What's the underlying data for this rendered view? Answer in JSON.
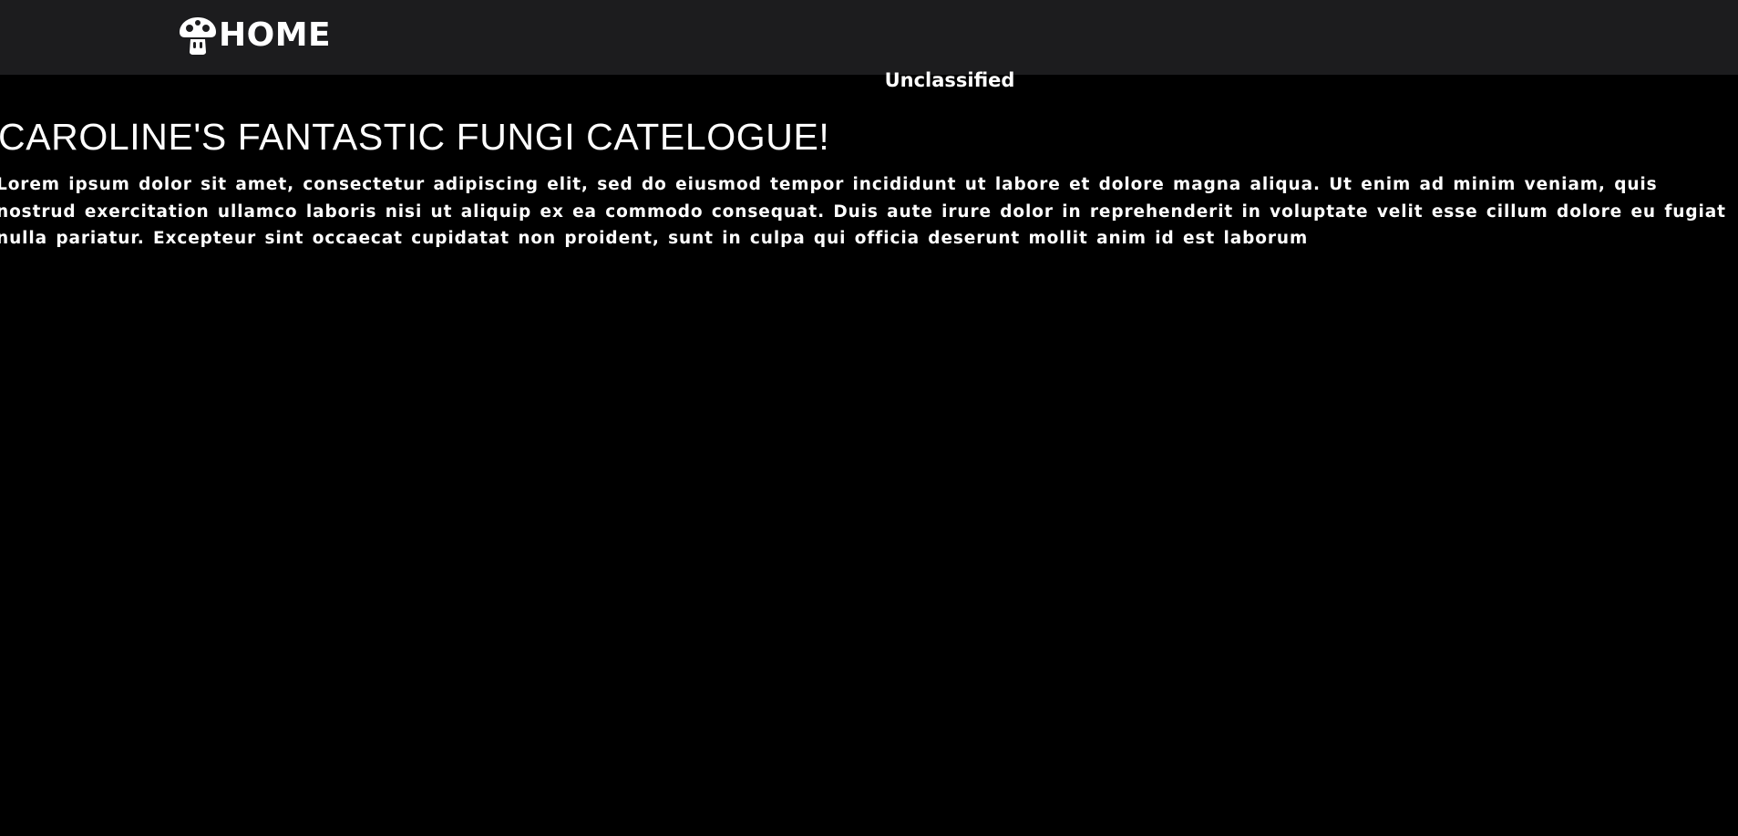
{
  "navbar": {
    "home_label": "HOME",
    "home_icon": "mushroom-icon",
    "background": "#1c1c1e"
  },
  "banner": {
    "classification": "Unclassified"
  },
  "main": {
    "title": "CAROLINE'S FANTASTIC FUNGI CATELOGUE!",
    "intro": "Lorem ipsum dolor sit amet, consectetur adipiscing elit, sed do eiusmod tempor incididunt ut labore et dolore magna aliqua. Ut enim ad minim veniam, quis nostrud exercitation ullamco laboris nisi ut aliquip ex ea commodo consequat. Duis aute irure dolor in reprehenderit in voluptate velit esse cillum dolore eu fugiat nulla pariatur. Excepteur sint occaecat cupidatat non proident, sunt in culpa qui officia deserunt mollit anim id est laborum"
  },
  "colors": {
    "page_background": "#000000",
    "text": "#ffffff"
  }
}
